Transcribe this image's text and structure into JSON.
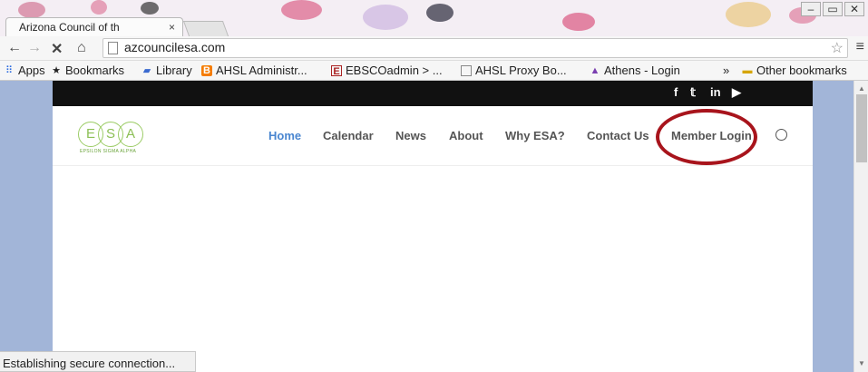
{
  "tab": {
    "title": "Arizona Council of th",
    "close": "×"
  },
  "window_controls": {
    "minimize": "–",
    "restore": "▭",
    "close": "✕"
  },
  "addressbar": {
    "back": "←",
    "forward": "→",
    "stop": "✕",
    "home": "⌂",
    "url": "azcouncilesa.com",
    "star": "☆",
    "menu": "≡"
  },
  "bookmarks": {
    "items": [
      {
        "label": "Apps",
        "icon": "apps-grid-icon"
      },
      {
        "label": "Bookmarks",
        "icon": "star-icon"
      },
      {
        "label": "Library",
        "icon": "library-icon"
      },
      {
        "label": "AHSL Administr...",
        "icon": "blogger-icon"
      },
      {
        "label": "EBSCOadmin > ...",
        "icon": "ebsco-icon"
      },
      {
        "label": "AHSL Proxy Bo...",
        "icon": "page-icon"
      },
      {
        "label": "Athens - Login",
        "icon": "athens-icon"
      }
    ],
    "more": "»",
    "other": "Other bookmarks"
  },
  "site": {
    "social": {
      "facebook": "f",
      "twitter": "𝕥",
      "linkedin": "in",
      "youtube": "▶"
    },
    "logo": {
      "letters": [
        "E",
        "S",
        "A"
      ],
      "tagline": "EPSILON SIGMA ALPHA"
    },
    "nav": [
      "Home",
      "Calendar",
      "News",
      "About",
      "Why ESA?",
      "Contact Us",
      "Member Login"
    ]
  },
  "status": "Establishing secure connection...",
  "colors": {
    "accent": "#4a86d0",
    "highlight_ring": "#a8141c",
    "side_bg": "#a2b5d8",
    "logo_green": "#8cbf55"
  }
}
